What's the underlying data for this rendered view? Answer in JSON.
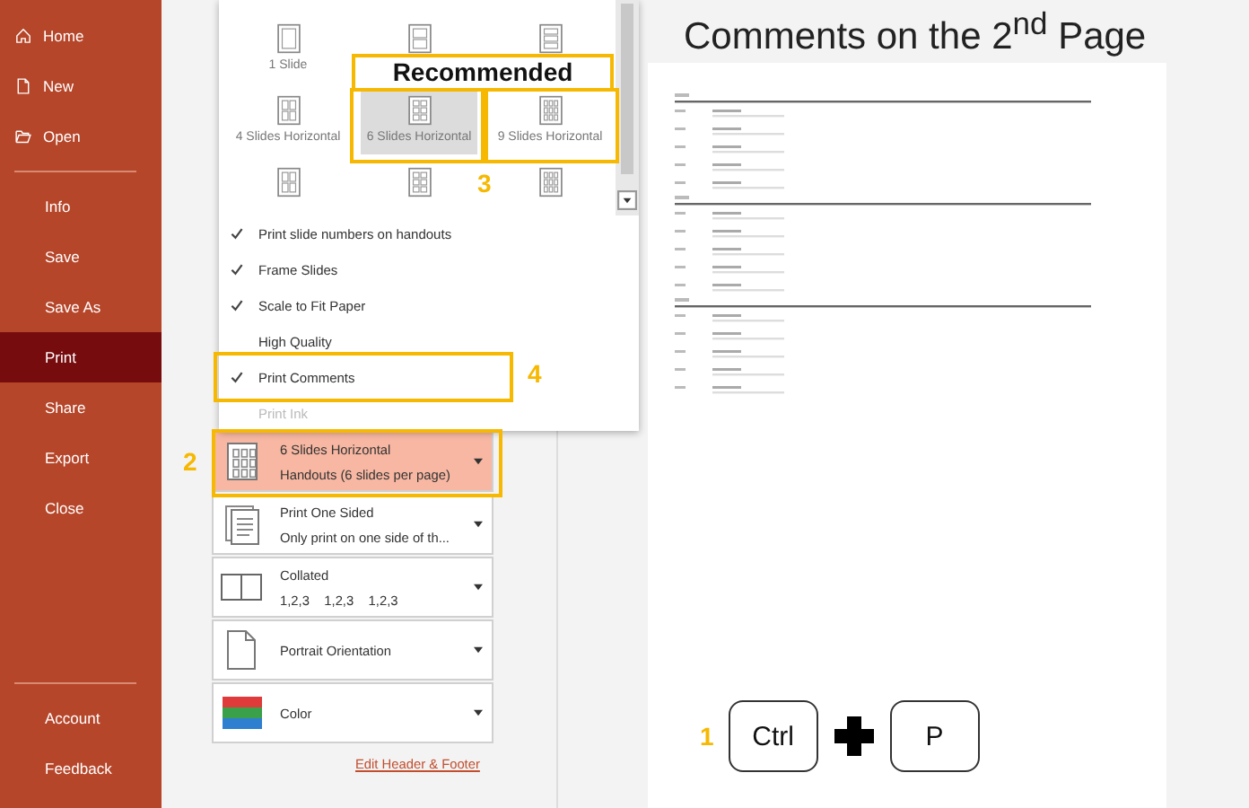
{
  "sidebar": {
    "nav": [
      {
        "label": "Home"
      },
      {
        "label": "New"
      },
      {
        "label": "Open"
      }
    ],
    "items": [
      {
        "label": "Info",
        "selected": false
      },
      {
        "label": "Save",
        "selected": false
      },
      {
        "label": "Save As",
        "selected": false
      },
      {
        "label": "Print",
        "selected": true
      },
      {
        "label": "Share",
        "selected": false
      },
      {
        "label": "Export",
        "selected": false
      },
      {
        "label": "Close",
        "selected": false
      }
    ],
    "footer": [
      {
        "label": "Account"
      },
      {
        "label": "Feedback"
      }
    ]
  },
  "layout_gallery": {
    "items": [
      {
        "label": "1 Slide",
        "selected": false
      },
      {
        "selected": false
      },
      {
        "selected": false
      },
      {
        "label": "4 Slides Horizontal",
        "selected": false
      },
      {
        "label": "6 Slides Horizontal",
        "selected": true
      },
      {
        "label": "9 Slides Horizontal",
        "selected": false
      },
      {
        "selected": false
      },
      {
        "selected": false
      },
      {
        "selected": false
      }
    ],
    "options": [
      {
        "label": "Print slide numbers on handouts",
        "checked": true,
        "disabled": false
      },
      {
        "label": "Frame Slides",
        "checked": true,
        "disabled": false
      },
      {
        "label": "Scale to Fit Paper",
        "checked": true,
        "disabled": false
      },
      {
        "label": "High Quality",
        "checked": false,
        "disabled": false
      },
      {
        "label": "Print Comments",
        "checked": true,
        "disabled": false
      },
      {
        "label": "Print Ink",
        "checked": false,
        "disabled": true
      }
    ]
  },
  "settings": [
    {
      "title": "6 Slides Horizontal",
      "subtitle": "Handouts (6 slides per page)",
      "selected": true
    },
    {
      "title": "Print One Sided",
      "subtitle": "Only print on one side of th...",
      "selected": false
    },
    {
      "title": "Collated",
      "subtitle": "1,2,3    1,2,3    1,2,3",
      "selected": false
    },
    {
      "title": "Portrait Orientation",
      "selected": false
    },
    {
      "title": "Color",
      "selected": false
    }
  ],
  "edit_link": "Edit Header & Footer",
  "preview": {
    "title": "Comments on the 2$^{nd}$ Page"
  },
  "annotations": [
    {
      "kind": "label",
      "text": "Recommended"
    },
    {
      "kind": "frame"
    },
    {
      "kind": "frame"
    },
    {
      "kind": "number",
      "text": "3"
    },
    {
      "kind": "frame"
    },
    {
      "kind": "number",
      "text": "4"
    },
    {
      "kind": "frame"
    },
    {
      "kind": "number",
      "text": "2"
    }
  ],
  "shortcut": {
    "number": "1",
    "keys": [
      "Ctrl",
      "P"
    ]
  }
}
